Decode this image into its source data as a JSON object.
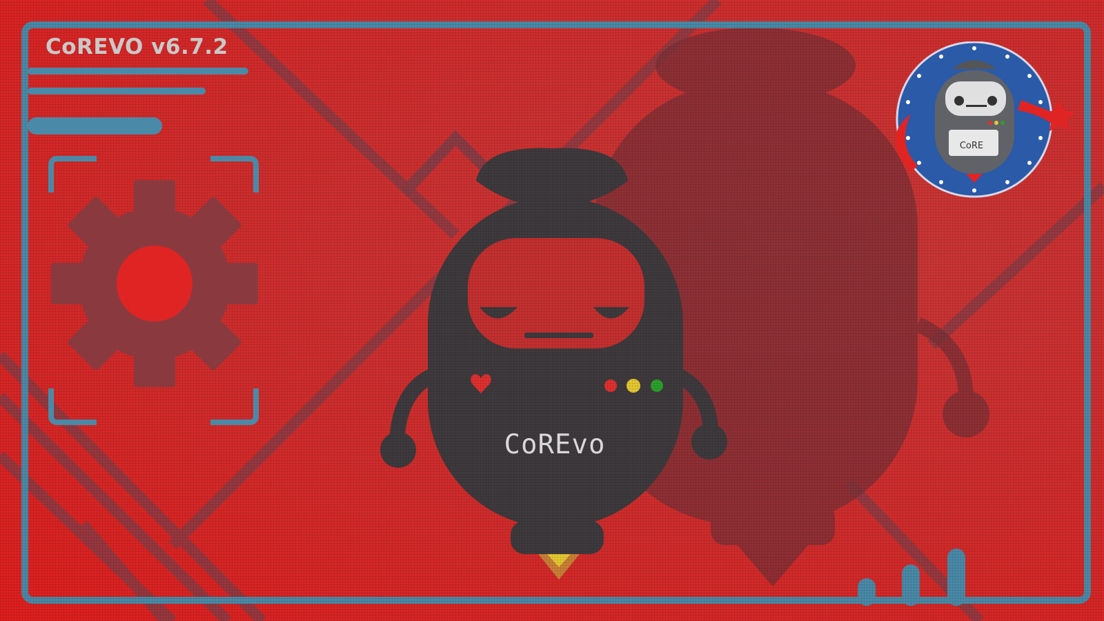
{
  "app": {
    "title": "CoREVO v6.7.2"
  },
  "mascot": {
    "label": "CoREvo"
  },
  "badge": {
    "label": "CoRE"
  },
  "icons": {
    "settings": "gear-icon",
    "status": "status-dots-icon",
    "heart": "heart-icon",
    "signal": "signal-bars-icon",
    "star": "star-icon"
  },
  "colors": {
    "background": "#d42a2a",
    "frame": "#4a8aa8",
    "shadow": "#3f3a3d",
    "text": "#c9c9c9",
    "dot_red": "#e03030",
    "dot_yellow": "#e6c832",
    "dot_green": "#2ca02c",
    "badge_blue": "#2a5aa8"
  }
}
